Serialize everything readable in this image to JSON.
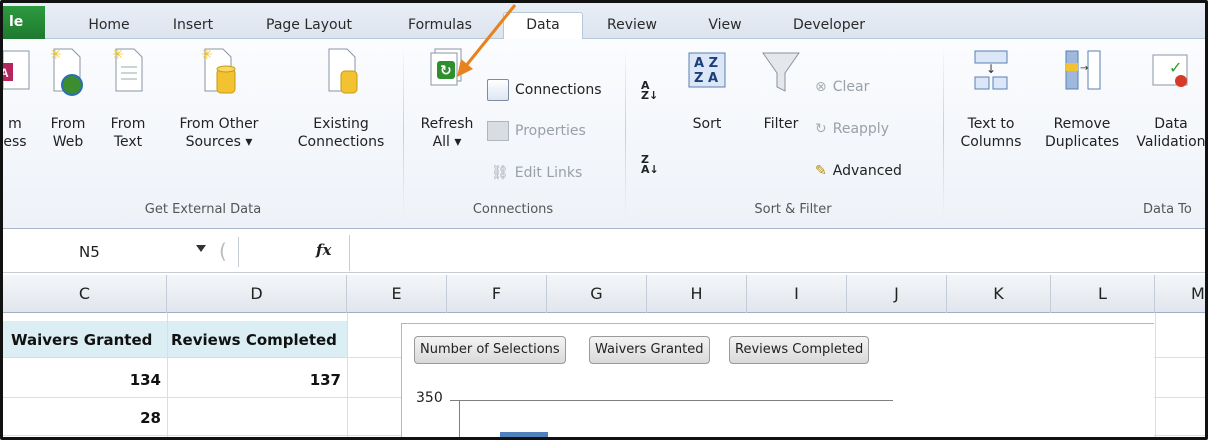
{
  "tabs": {
    "file": "le",
    "home": "Home",
    "insert": "Insert",
    "page_layout": "Page Layout",
    "formulas": "Formulas",
    "data": "Data",
    "review": "Review",
    "view": "View",
    "developer": "Developer"
  },
  "ribbon": {
    "get_external_data": {
      "label": "Get External Data",
      "from_access": [
        "m",
        "ess"
      ],
      "from_web": [
        "From",
        "Web"
      ],
      "from_text": [
        "From",
        "Text"
      ],
      "from_other": [
        "From Other",
        "Sources ▾"
      ],
      "existing": [
        "Existing",
        "Connections"
      ]
    },
    "connections": {
      "label": "Connections",
      "refresh": [
        "Refresh",
        "All ▾"
      ],
      "connections": "Connections",
      "properties": "Properties",
      "edit_links": "Edit Links"
    },
    "sort_filter": {
      "label": "Sort & Filter",
      "sort": "Sort",
      "filter": "Filter",
      "clear": "Clear",
      "reapply": "Reapply",
      "advanced": "Advanced"
    },
    "data_tools": {
      "label": "Data To",
      "text_to_columns": [
        "Text to",
        "Columns"
      ],
      "remove_duplicates": [
        "Remove",
        "Duplicates"
      ],
      "data_validation": [
        "Data",
        "Validation"
      ]
    }
  },
  "formula_bar": {
    "name_box": "N5",
    "fx": "fx",
    "value": ""
  },
  "columns": [
    "C",
    "D",
    "E",
    "F",
    "G",
    "H",
    "I",
    "J",
    "K",
    "L",
    "M"
  ],
  "cells": {
    "c1": "Waivers Granted",
    "d1": "Reviews Completed",
    "c2": "134",
    "d2": "137",
    "c3": "28"
  },
  "chart": {
    "legend": [
      "Number of Selections",
      "Waivers Granted",
      "Reviews Completed"
    ],
    "y_tick": "350"
  },
  "colors": {
    "accent_arrow": "#e8821e",
    "bar": "#4f81bd",
    "file_tab": "#1f7a2f"
  }
}
